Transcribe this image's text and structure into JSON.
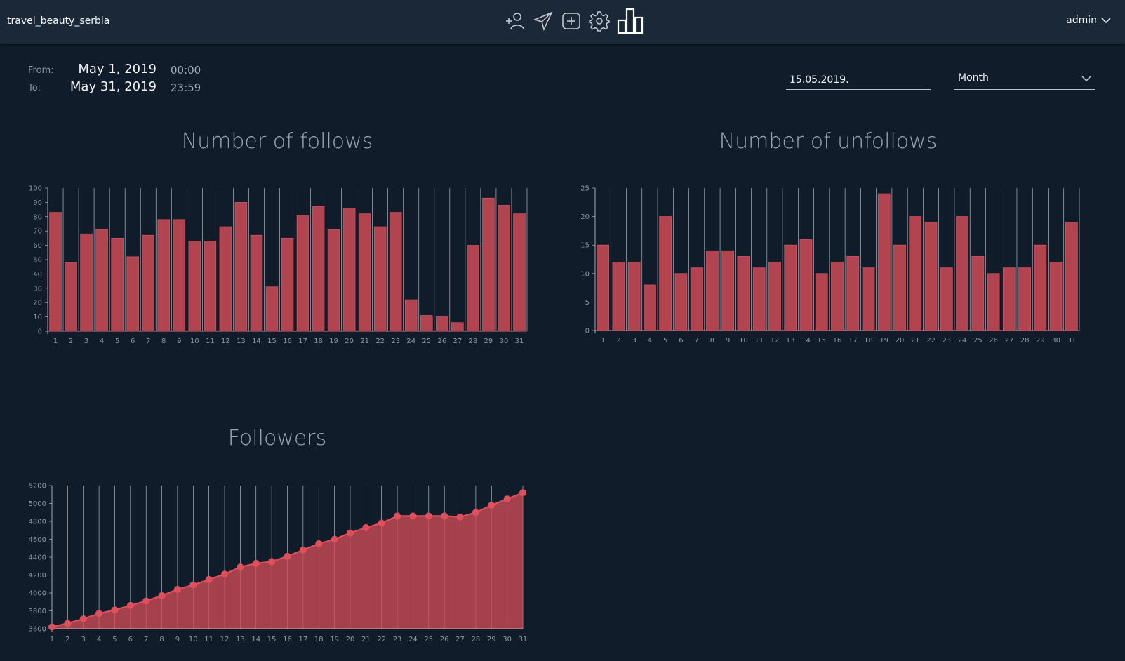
{
  "header": {
    "account": "travel_beauty_serbia",
    "user": "admin",
    "icons": [
      "add-user-icon",
      "send-icon",
      "add-post-icon",
      "settings-icon",
      "statistics-icon"
    ]
  },
  "range": {
    "from_label": "From:",
    "from_date": "May 1, 2019",
    "from_time": "00:00",
    "to_label": "To:",
    "to_date": "May 31, 2019",
    "to_time": "23:59"
  },
  "controls": {
    "date_value": "15.05.2019.",
    "period_value": "Month"
  },
  "colors": {
    "bar": "#b2444f",
    "bar_stroke": "#d15561",
    "point": "#e0505c",
    "grid": "#c8ccd3"
  },
  "chart_data": [
    {
      "type": "bar",
      "title": "Number of follows",
      "categories": [
        "1",
        "2",
        "3",
        "4",
        "5",
        "6",
        "7",
        "8",
        "9",
        "10",
        "11",
        "12",
        "13",
        "14",
        "15",
        "16",
        "17",
        "18",
        "19",
        "20",
        "21",
        "22",
        "23",
        "24",
        "25",
        "26",
        "27",
        "28",
        "29",
        "30",
        "31"
      ],
      "values": [
        83,
        48,
        68,
        71,
        65,
        52,
        67,
        78,
        78,
        63,
        63,
        73,
        90,
        67,
        31,
        65,
        81,
        87,
        71,
        86,
        82,
        73,
        83,
        22,
        11,
        10,
        6,
        60,
        93,
        88,
        82
      ],
      "ylim": [
        0,
        100
      ],
      "yticks": [
        0,
        10,
        20,
        30,
        40,
        50,
        60,
        70,
        80,
        90,
        100
      ],
      "grid": "vertical"
    },
    {
      "type": "bar",
      "title": "Number of unfollows",
      "categories": [
        "1",
        "2",
        "3",
        "4",
        "5",
        "6",
        "7",
        "8",
        "9",
        "10",
        "11",
        "12",
        "13",
        "14",
        "15",
        "16",
        "17",
        "18",
        "19",
        "20",
        "21",
        "22",
        "23",
        "24",
        "25",
        "26",
        "27",
        "28",
        "29",
        "30",
        "31"
      ],
      "values": [
        15,
        12,
        12,
        8,
        20,
        10,
        11,
        14,
        14,
        13,
        11,
        12,
        15,
        16,
        10,
        12,
        13,
        11,
        24,
        15,
        20,
        19,
        11,
        20,
        13,
        10,
        11,
        11,
        15,
        12,
        19
      ],
      "ylim": [
        0,
        25
      ],
      "yticks": [
        0,
        5,
        10,
        15,
        20,
        25
      ],
      "grid": "vertical"
    },
    {
      "type": "area",
      "title": "Followers",
      "categories": [
        "1",
        "2",
        "3",
        "4",
        "5",
        "6",
        "7",
        "8",
        "9",
        "10",
        "11",
        "12",
        "13",
        "14",
        "15",
        "16",
        "17",
        "18",
        "19",
        "20",
        "21",
        "22",
        "23",
        "24",
        "25",
        "26",
        "27",
        "28",
        "29",
        "30",
        "31"
      ],
      "values": [
        3620,
        3660,
        3710,
        3770,
        3810,
        3860,
        3910,
        3970,
        4040,
        4090,
        4150,
        4210,
        4290,
        4330,
        4350,
        4410,
        4480,
        4550,
        4600,
        4670,
        4730,
        4780,
        4860,
        4860,
        4860,
        4860,
        4850,
        4900,
        4980,
        5050,
        5120
      ],
      "ylim": [
        3600,
        5200
      ],
      "yticks": [
        3600,
        3800,
        4000,
        4200,
        4400,
        4600,
        4800,
        5000,
        5200
      ],
      "grid": "vertical"
    }
  ]
}
